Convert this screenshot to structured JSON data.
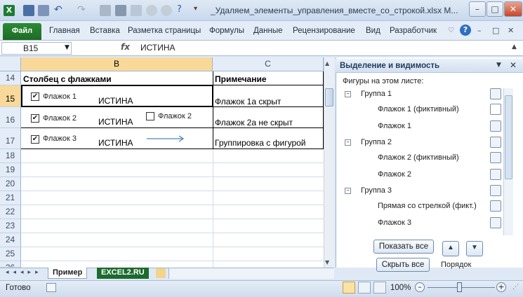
{
  "title": "_Удаляем_элементы_управления_вместе_со_строкой.xlsx M...",
  "ribbon": {
    "file": "Файл",
    "tabs": [
      "Главная",
      "Вставка",
      "Разметка страницы",
      "Формулы",
      "Данные",
      "Рецензирование",
      "Вид",
      "Разработчик"
    ]
  },
  "formula_bar": {
    "name_box": "B15",
    "fx": "fx",
    "value": "ИСТИНА"
  },
  "columns": {
    "b": "B",
    "c": "C"
  },
  "rows": [
    "14",
    "15",
    "16",
    "17",
    "18",
    "19",
    "20",
    "21",
    "22",
    "23",
    "24",
    "25",
    "26"
  ],
  "cells": {
    "b14": "Столбец с флажками",
    "c14": "Примечание",
    "b15": "ИСТИНА",
    "b16": "ИСТИНА",
    "b17": "ИСТИНА",
    "c15": "Флажок 1а скрыт",
    "c16": "Флажок 2а не скрыт",
    "c17": "Группировка с фигурой"
  },
  "checkboxes": {
    "cb1": {
      "label": "Флажок 1",
      "checked": true
    },
    "cb2": {
      "label": "Флажок 2",
      "checked": true
    },
    "cb2b": {
      "label": "Флажок 2",
      "checked": false
    },
    "cb3": {
      "label": "Флажок 3",
      "checked": true
    }
  },
  "sheet_tabs": {
    "active": "Пример",
    "other": "EXCEL2.RU"
  },
  "pane": {
    "title": "Выделение и видимость",
    "subtitle": "Фигуры на этом листе:",
    "g1": "Группа 1",
    "g1a": "Флажок 1 (фиктивный)",
    "g1b": "Флажок 1",
    "g2": "Группа 2",
    "g2a": "Флажок 2 (фиктивный)",
    "g2b": "Флажок 2",
    "g3": "Группа 3",
    "g3a": "Прямая со стрелкой (фикт.)",
    "g3b": "Флажок 3",
    "show_all": "Показать все",
    "hide_all": "Скрыть все",
    "order": "Порядок"
  },
  "status": {
    "ready": "Готово",
    "zoom": "100%"
  },
  "icons": [
    "excel-logo-icon",
    "save-icon",
    "undo-icon",
    "redo-icon",
    "eye-icon",
    "help-icon"
  ]
}
